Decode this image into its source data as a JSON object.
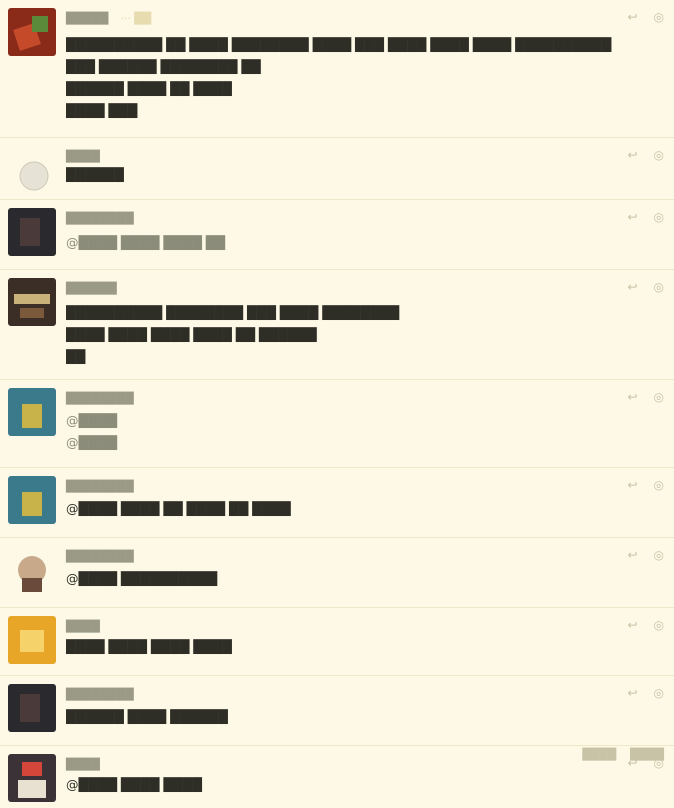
{
  "posts": [
    {
      "author": "█████",
      "time": "··· ██",
      "lines": [
        "██████████ ██ ████ ████████ ████ ███ ████ ████ ████ ██████████",
        "███ ██████ ████████ ██",
        "██████ ████ ██ ████",
        "████ ███"
      ]
    },
    {
      "author": "████",
      "time": "",
      "lines": [
        "██████"
      ]
    },
    {
      "author": "████████",
      "time": "",
      "lines": [
        "@████ ████ ████ ██"
      ]
    },
    {
      "author": "██████",
      "time": "",
      "lines": [
        "██████████ ████████ ███ ████ ████████",
        "████ ████ ████ ████ ██ ██████",
        "██"
      ]
    },
    {
      "author": "████████",
      "time": "",
      "lines": [
        "@████",
        "@████"
      ]
    },
    {
      "author": "████████",
      "time": "",
      "lines": [
        "@████ ████ ██ ████ ██ ████"
      ]
    },
    {
      "author": "████████",
      "time": "",
      "lines": [
        "@████ ██████████"
      ]
    },
    {
      "author": "████",
      "time": "",
      "lines": [
        "████ ████ ████ ████"
      ]
    },
    {
      "author": "████████",
      "time": "",
      "lines": [
        "██████ ████ ██████"
      ]
    },
    {
      "author": "████",
      "time": "",
      "lines": [
        "@████ ████ ████"
      ],
      "extra": [
        "████",
        "████"
      ]
    }
  ],
  "icons": {
    "reply": "reply-icon",
    "more": "more-icon"
  },
  "colors": {
    "background": "#fdf9e6",
    "author": "#9a9a86",
    "text": "#2e2e26",
    "muted": "#c8c2a6"
  }
}
